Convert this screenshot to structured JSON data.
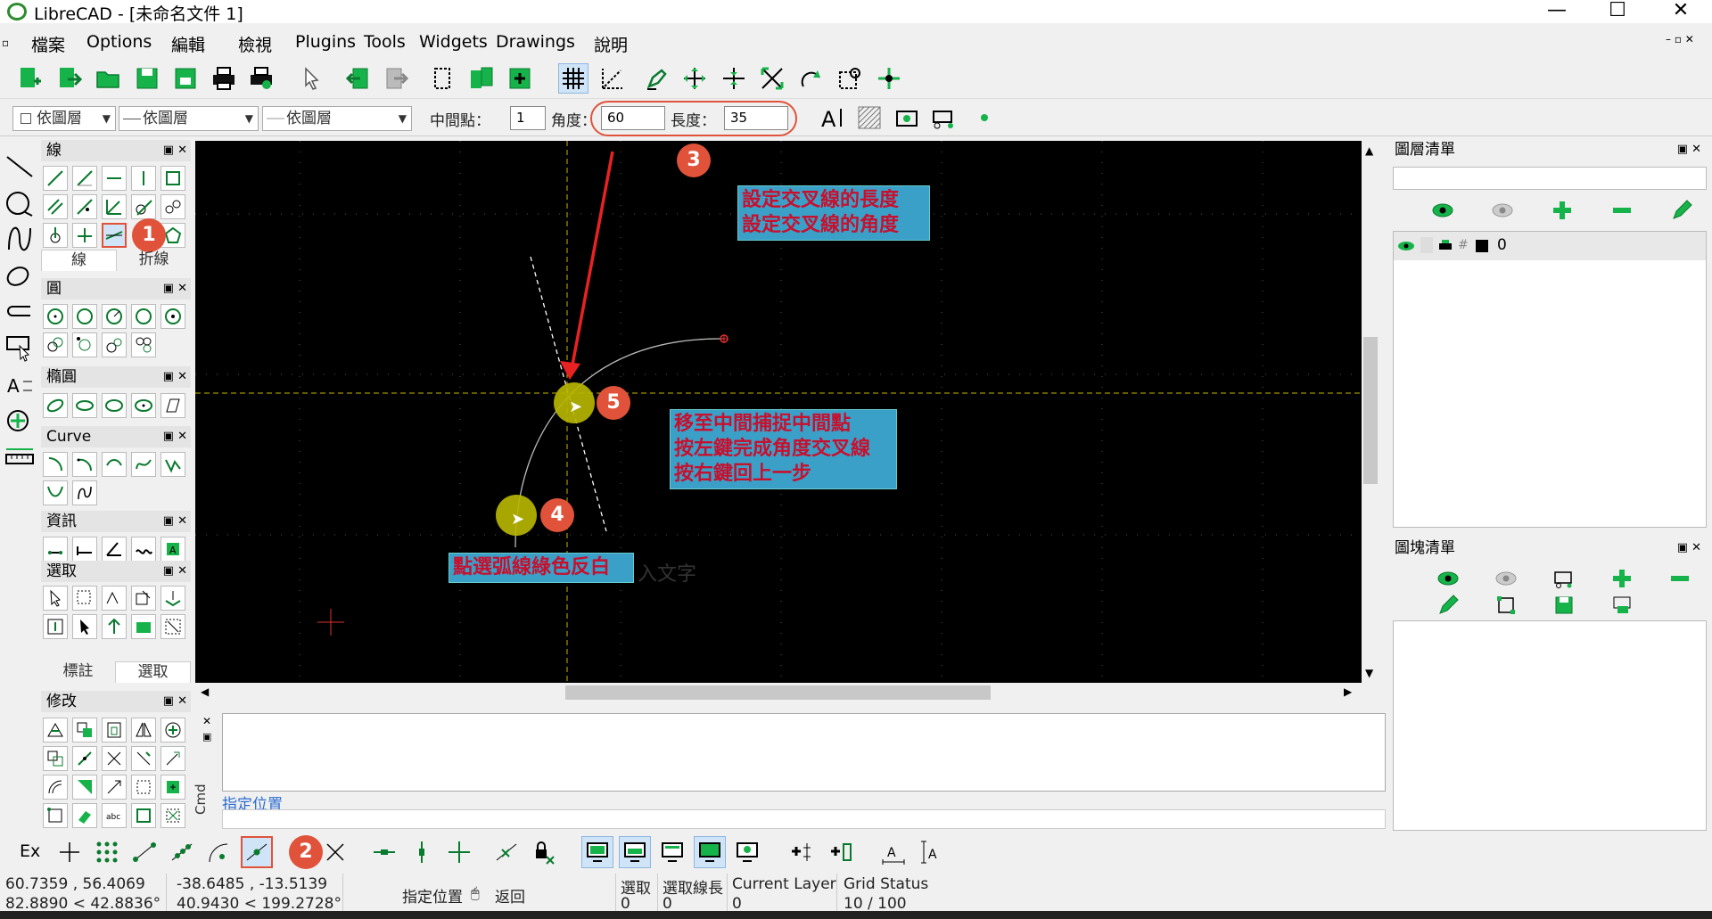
{
  "window": {
    "title": "LibreCAD - [未命名文件 1]",
    "minimize": "—",
    "maximize": "☐",
    "close": "✕"
  },
  "menu": [
    "檔案",
    "Options",
    "編輯",
    "檢視",
    "Plugins",
    "Tools",
    "Widgets",
    "Drawings",
    "說明"
  ],
  "toolbar2": {
    "layer_combo": "依圖層",
    "linetype_combo": "依圖層",
    "linewidth_combo": "依圖層",
    "midpoints_label": "中間點：",
    "midpoints_value": "1",
    "angle_label": "角度：",
    "angle_value": "60",
    "length_label": "長度：",
    "length_value": "35"
  },
  "panels": {
    "line": {
      "title": "線",
      "tabs": [
        "線",
        "折線"
      ]
    },
    "circle": {
      "title": "圓"
    },
    "ellipse": {
      "title": "橢圓"
    },
    "curve": {
      "title": "Curve"
    },
    "info": {
      "title": "資訊"
    },
    "select": {
      "title": "選取",
      "tabs": [
        "標註",
        "選取"
      ]
    },
    "modify": {
      "title": "修改"
    }
  },
  "layer_list": {
    "title": "圖層清單",
    "filter_placeholder": "",
    "layers": [
      {
        "name": "0"
      }
    ]
  },
  "block_list": {
    "title": "圖塊清單"
  },
  "command": {
    "side_label": "Cmd",
    "prompt": "指定位置"
  },
  "snap": {
    "ex_label": "Ex"
  },
  "status": {
    "abs_coord": "60.7359 , 56.4069",
    "abs_polar": "82.8890 < 42.8836°",
    "rel_coord": "-38.6485 , -13.5139",
    "rel_polar": "40.9430 < 199.2728°",
    "mouse_left": "指定位置",
    "mouse_right": "返回",
    "selected_label": "選取",
    "selected_value": "0",
    "sel_length_label": "選取線長",
    "sel_length_value": "0",
    "current_layer_label": "Current Layer",
    "current_layer_value": "0",
    "grid_label": "Grid Status",
    "grid_value": "10 / 100"
  },
  "annotations": {
    "note_angle_length": [
      "設定交叉線的長度",
      "設定交叉線的角度"
    ],
    "note_midpoint": [
      "移至中間捕捉中間點",
      "按左鍵完成角度交叉線",
      "按右鍵回上一步"
    ],
    "note_arc": "點選弧線綠色反白",
    "ghost_text": "入文字",
    "badges": [
      "1",
      "2",
      "3",
      "4",
      "5"
    ]
  },
  "colors": {
    "accent": "#e0533a",
    "note_bg": "#3aa0c8",
    "note_text": "#c8102e",
    "canvas": "#000000",
    "icon_green": "#16b34a"
  }
}
